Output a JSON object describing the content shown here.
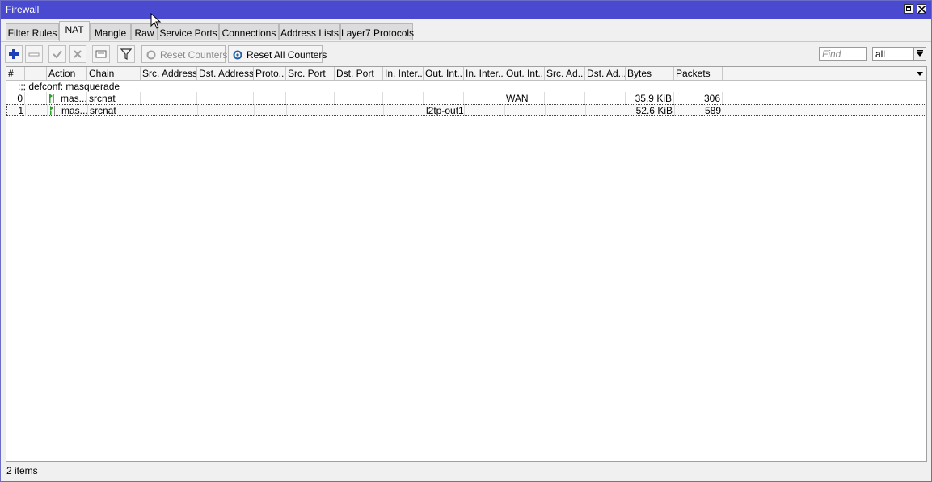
{
  "window": {
    "title": "Firewall"
  },
  "tabs": [
    {
      "label": "Filter Rules"
    },
    {
      "label": "NAT",
      "active": true
    },
    {
      "label": "Mangle"
    },
    {
      "label": "Raw"
    },
    {
      "label": "Service Ports"
    },
    {
      "label": "Connections"
    },
    {
      "label": "Address Lists"
    },
    {
      "label": "Layer7 Protocols"
    }
  ],
  "toolbar": {
    "add_icon": "plus-icon",
    "remove_icon": "minus-icon",
    "enable_icon": "check-icon",
    "disable_icon": "x-icon",
    "comment_icon": "comment-icon",
    "filter_icon": "funnel-icon",
    "reset_counters_label": "Reset Counters",
    "reset_all_counters_label": "Reset All Counters",
    "find_placeholder": "Find",
    "scope_value": "all"
  },
  "table": {
    "columns": [
      "#",
      "",
      "Action",
      "Chain",
      "Src. Address",
      "Dst. Address",
      "Proto...",
      "Src. Port",
      "Dst. Port",
      "In. Inter...",
      "Out. Int...",
      "In. Inter...",
      "Out. Int...",
      "Src. Ad...",
      "Dst. Ad...",
      "Bytes",
      "Packets"
    ],
    "comment": ";;; defconf: masquerade",
    "rows": [
      {
        "num": "0",
        "action": "mas...",
        "chain": "srcnat",
        "out_interface": "",
        "out_interface_list": "WAN",
        "bytes": "35.9 KiB",
        "packets": "306",
        "selected": false
      },
      {
        "num": "1",
        "action": "mas...",
        "chain": "srcnat",
        "out_interface": "l2tp-out1",
        "out_interface_list": "",
        "bytes": "52.6 KiB",
        "packets": "589",
        "selected": true
      }
    ]
  },
  "status": {
    "items_text": "2 items"
  },
  "colors": {
    "titlebar": "#4a4ad0",
    "add_icon": "#1f3fb8",
    "action_icon": "#2aa02a"
  }
}
